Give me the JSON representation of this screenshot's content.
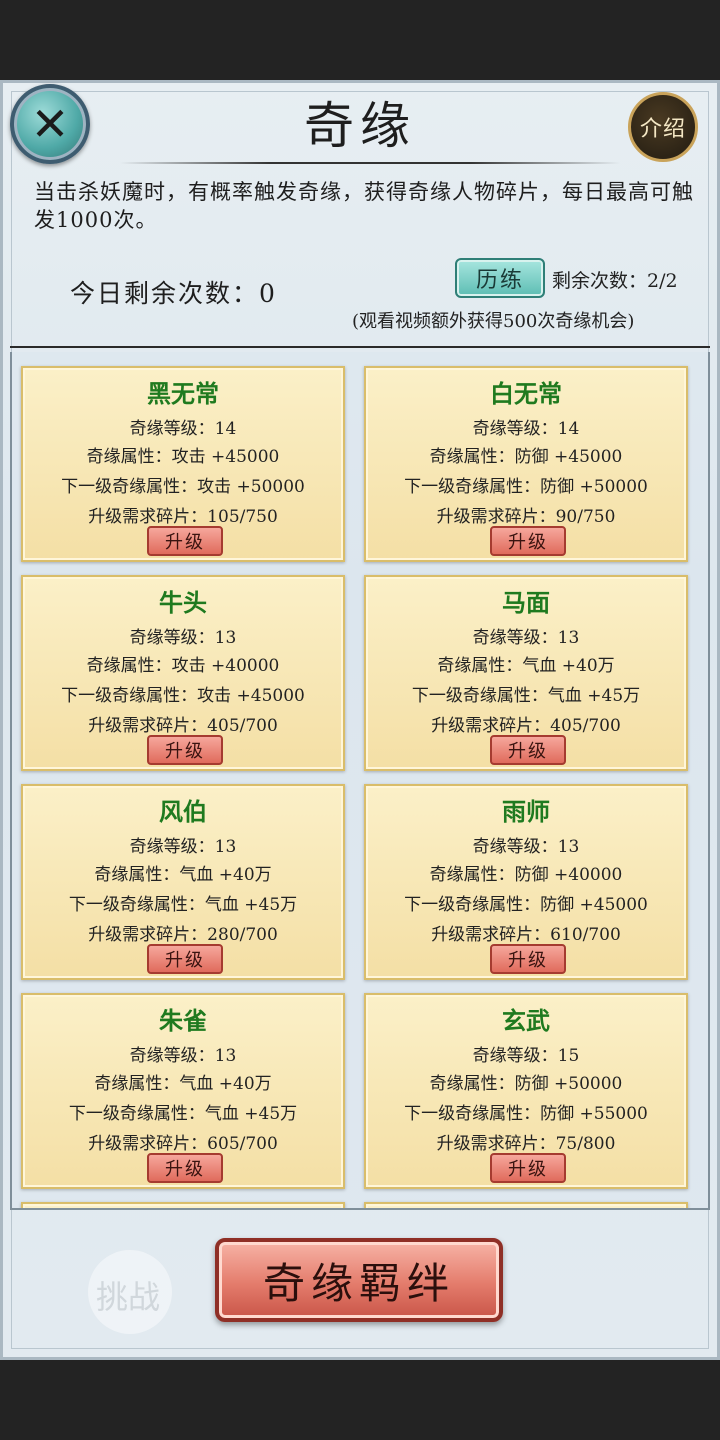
{
  "header": {
    "title": "奇缘",
    "intro_label": "介绍"
  },
  "description": "当击杀妖魔时，有概率触发奇缘，获得奇缘人物碎片，每日最高可触发1000次。",
  "status": {
    "remaining_today": "今日剩余次数：0",
    "train_label": "历练",
    "remaining_count": "剩余次数：2/2",
    "video_hint": "(观看视频额外获得500次奇缘机会)"
  },
  "cards": [
    {
      "name": "黑无常",
      "level": "奇缘等级：14",
      "attr": "奇缘属性：攻击 +45000",
      "next": "下一级奇缘属性：攻击 +50000",
      "need": "升级需求碎片：105/750",
      "button": "升级"
    },
    {
      "name": "白无常",
      "level": "奇缘等级：14",
      "attr": "奇缘属性：防御 +45000",
      "next": "下一级奇缘属性：防御 +50000",
      "need": "升级需求碎片：90/750",
      "button": "升级"
    },
    {
      "name": "牛头",
      "level": "奇缘等级：13",
      "attr": "奇缘属性：攻击 +40000",
      "next": "下一级奇缘属性：攻击 +45000",
      "need": "升级需求碎片：405/700",
      "button": "升级"
    },
    {
      "name": "马面",
      "level": "奇缘等级：13",
      "attr": "奇缘属性：气血 +40万",
      "next": "下一级奇缘属性：气血 +45万",
      "need": "升级需求碎片：405/700",
      "button": "升级"
    },
    {
      "name": "风伯",
      "level": "奇缘等级：13",
      "attr": "奇缘属性：气血 +40万",
      "next": "下一级奇缘属性：气血 +45万",
      "need": "升级需求碎片：280/700",
      "button": "升级"
    },
    {
      "name": "雨师",
      "level": "奇缘等级：13",
      "attr": "奇缘属性：防御 +40000",
      "next": "下一级奇缘属性：防御 +45000",
      "need": "升级需求碎片：610/700",
      "button": "升级"
    },
    {
      "name": "朱雀",
      "level": "奇缘等级：13",
      "attr": "奇缘属性：气血 +40万",
      "next": "下一级奇缘属性：气血 +45万",
      "need": "升级需求碎片：605/700",
      "button": "升级"
    },
    {
      "name": "玄武",
      "level": "奇缘等级：15",
      "attr": "奇缘属性：防御 +50000",
      "next": "下一级奇缘属性：防御 +55000",
      "need": "升级需求碎片：75/800",
      "button": "升级"
    }
  ],
  "bond_button": "奇缘羁绊",
  "background_labels": {
    "challenge": "挑战"
  },
  "icons": {
    "close": "close-icon"
  },
  "colors": {
    "card_name": "#1f7a1f",
    "upgrade_button": "#e06b5c",
    "train_button": "#5dbdb3"
  }
}
